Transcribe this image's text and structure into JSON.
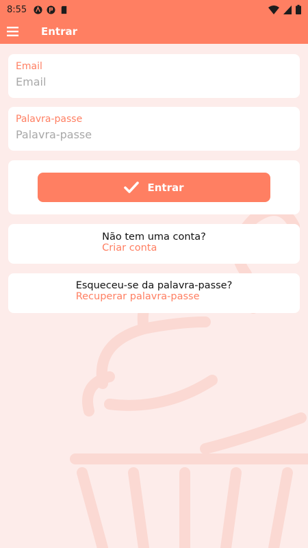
{
  "status_bar": {
    "time": "8:55"
  },
  "app_bar": {
    "title": "Entrar",
    "menu_icon": "hamburger-menu-icon"
  },
  "email_field": {
    "label": "Email",
    "placeholder": "Email",
    "value": ""
  },
  "password_field": {
    "label": "Palavra-passe",
    "placeholder": "Palavra-passe",
    "value": ""
  },
  "login_button": {
    "label": "Entrar",
    "icon": "checkmark-icon"
  },
  "signup_prompt": {
    "text": "Não tem uma conta?",
    "link": "Criar conta"
  },
  "recover_prompt": {
    "text": "Esqueceu-se da palavra-passe?",
    "link": "Recuperar palavra-passe"
  },
  "colors": {
    "primary": "#ff7f62",
    "background": "#fdecea",
    "card": "#ffffff"
  }
}
